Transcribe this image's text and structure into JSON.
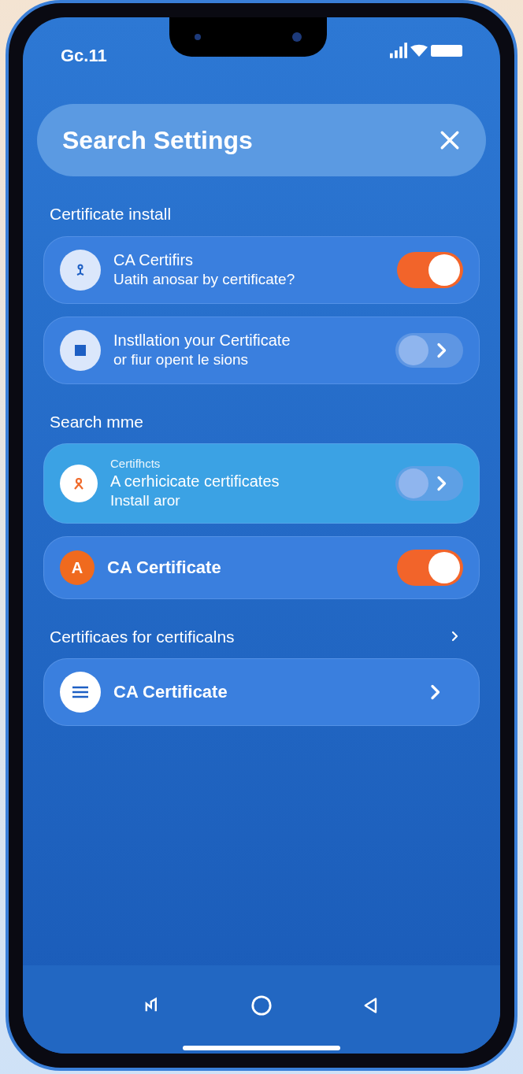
{
  "status_bar": {
    "time": "Gc.11"
  },
  "search": {
    "title": "Search Settings"
  },
  "sections": [
    {
      "title": "Certificate install",
      "items": [
        {
          "kind": "toggle",
          "selected": false,
          "lines": [
            "CA Certifirs",
            "Uatih anosar by certificate?"
          ],
          "on": true
        },
        {
          "kind": "pill-arrow",
          "selected": false,
          "lines": [
            "Instllation your Certificate",
            "or fiur opent le sions"
          ]
        }
      ]
    },
    {
      "title": "Search mme",
      "items": [
        {
          "kind": "pill-arrow",
          "selected": true,
          "caption": "Certifhcts",
          "lines": [
            "A cerhicicate certificates",
            "Install aror"
          ]
        },
        {
          "kind": "toggle",
          "selected": false,
          "avatar": "A",
          "lines": [
            "CA Certificate"
          ],
          "on": true
        }
      ]
    },
    {
      "title": "Certificaes for certificalns",
      "link": true,
      "items": [
        {
          "kind": "chevron",
          "selected": false,
          "lines": [
            "CA Certificate"
          ]
        }
      ]
    }
  ]
}
